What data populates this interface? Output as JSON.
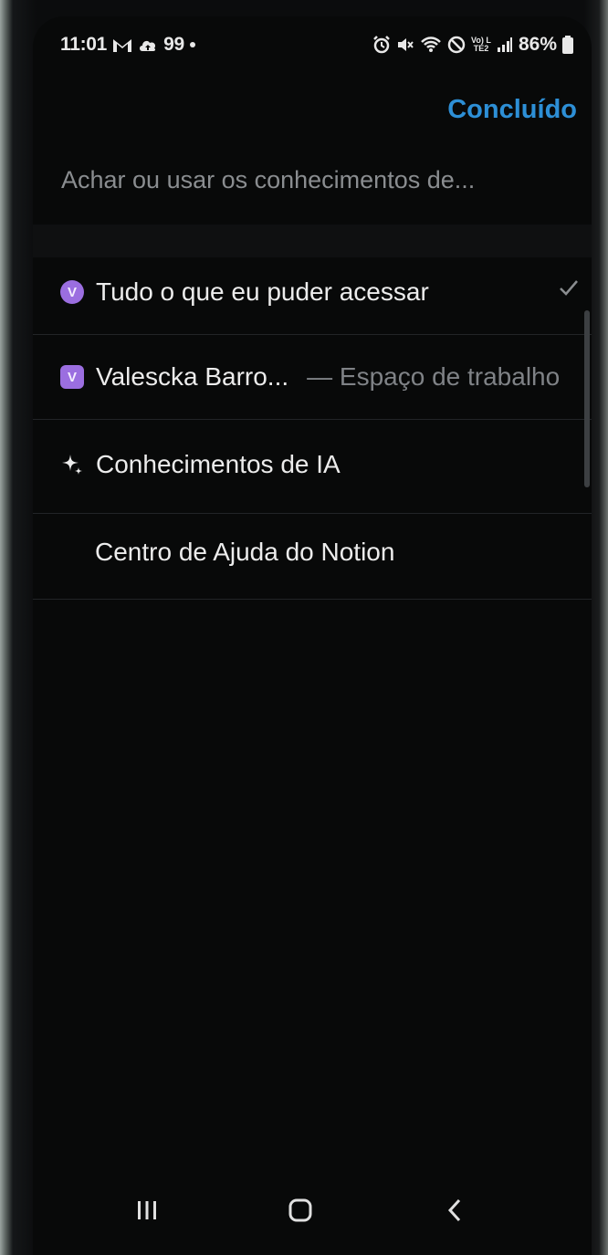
{
  "status_bar": {
    "time": "11:01",
    "left_icons": [
      "gmail-icon",
      "cloud-upload-icon"
    ],
    "notification_count": "99",
    "right_icons": [
      "alarm-icon",
      "mute-icon",
      "wifi-icon",
      "do-not-disturb-icon",
      "volte-icon",
      "signal-icon"
    ],
    "volte_label": "Vo) LTE2",
    "battery": "86%"
  },
  "header": {
    "done_label": "Concluído",
    "search_placeholder": "Achar ou usar os conhecimentos de..."
  },
  "options": [
    {
      "badge": "V",
      "label": "Tudo o que eu puder acessar",
      "selected": true
    },
    {
      "badge": "V",
      "label": "Valescka Barro...",
      "secondary": "— Espaço de trabalho"
    },
    {
      "icon": "sparkle-icon",
      "label": "Conhecimentos de IA"
    },
    {
      "label": "Centro de Ajuda do Notion"
    }
  ],
  "nav_bar": {
    "icons": [
      "recents-icon",
      "home-icon",
      "back-icon"
    ]
  },
  "colors": {
    "accent": "#2d8fd6",
    "badge": "#9b6ee0",
    "background": "#080909"
  }
}
